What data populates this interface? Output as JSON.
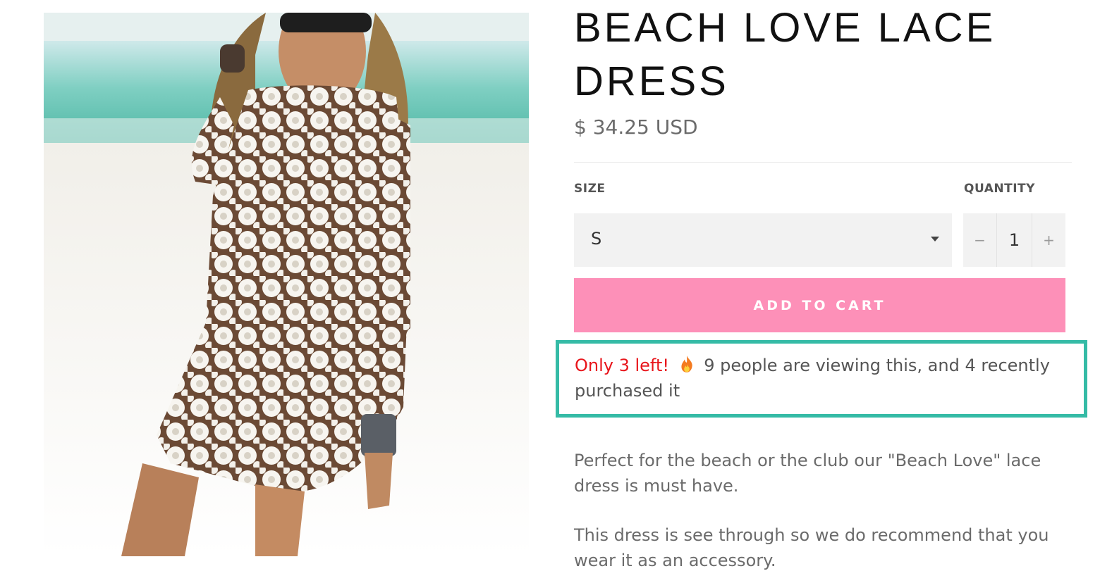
{
  "product": {
    "title_line1": "BEACH LOVE LACE",
    "title_line2": "DRESS",
    "price": "$ 34.25 USD",
    "image_alt": "Woman on a beach wearing a white lace dress"
  },
  "options": {
    "size_label": "SIZE",
    "size_value": "S",
    "quantity_label": "QUANTITY",
    "quantity_value": "1",
    "minus_symbol": "−",
    "plus_symbol": "+"
  },
  "cart": {
    "add_to_cart_label": "ADD TO CART",
    "button_color": "#fd90b8"
  },
  "scarcity": {
    "stock_text": "Only 3 left!",
    "viewing_text": "9 people are viewing this, and 4 recently purchased it",
    "icon": "fire-icon",
    "stock_color": "#e8151b",
    "highlight_border_color": "#35bba6"
  },
  "description": {
    "paragraph1": "Perfect for the beach or the club our \"Beach Love\" lace dress is must have.",
    "paragraph2": "This dress is see through so we do recommend that you wear it as an accessory."
  }
}
